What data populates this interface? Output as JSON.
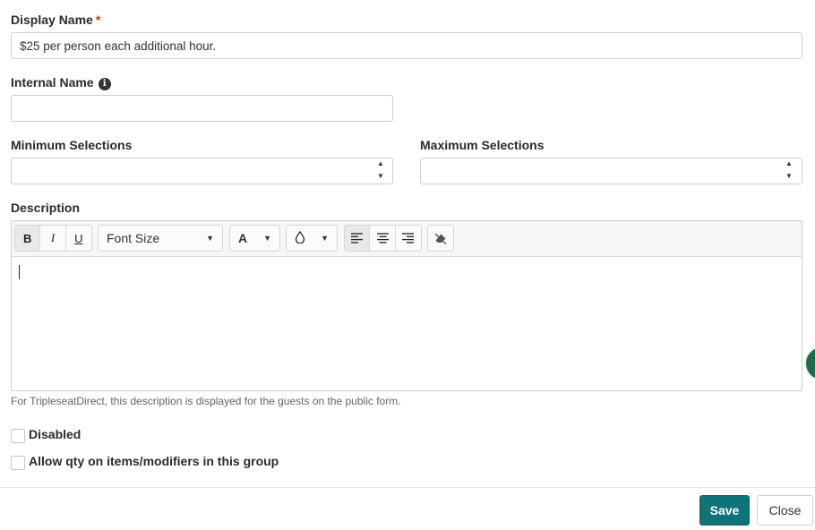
{
  "display_name": {
    "label": "Display Name",
    "required_marker": "*",
    "value": "$25 per person each additional hour."
  },
  "internal_name": {
    "label": "Internal Name",
    "info_glyph": "i",
    "value": ""
  },
  "minimum_selections": {
    "label": "Minimum Selections",
    "value": "",
    "up": "▲",
    "down": "▼"
  },
  "maximum_selections": {
    "label": "Maximum Selections",
    "value": "",
    "up": "▲",
    "down": "▼"
  },
  "description": {
    "label": "Description",
    "toolbar": {
      "bold": "B",
      "italic": "I",
      "underline": "U",
      "font_size": "Font Size",
      "font_color": "A",
      "highlight_icon": "droplet-icon",
      "caret": "▼",
      "align_left_icon": "align-left-icon",
      "align_center_icon": "align-center-icon",
      "align_right_icon": "align-right-icon",
      "clear_format_icon": "eraser-icon"
    },
    "content": "",
    "help_text": "For TripleseatDirect, this description is displayed for the guests on the public form."
  },
  "checkboxes": [
    {
      "label": "Disabled",
      "checked": false
    },
    {
      "label": "Allow qty on items/modifiers in this group",
      "checked": false
    }
  ],
  "buttons": {
    "save": "Save",
    "close": "Close"
  },
  "colors": {
    "primary": "#0f7378",
    "required": "#c0392b",
    "chat_widget": "#1c6b4a"
  }
}
